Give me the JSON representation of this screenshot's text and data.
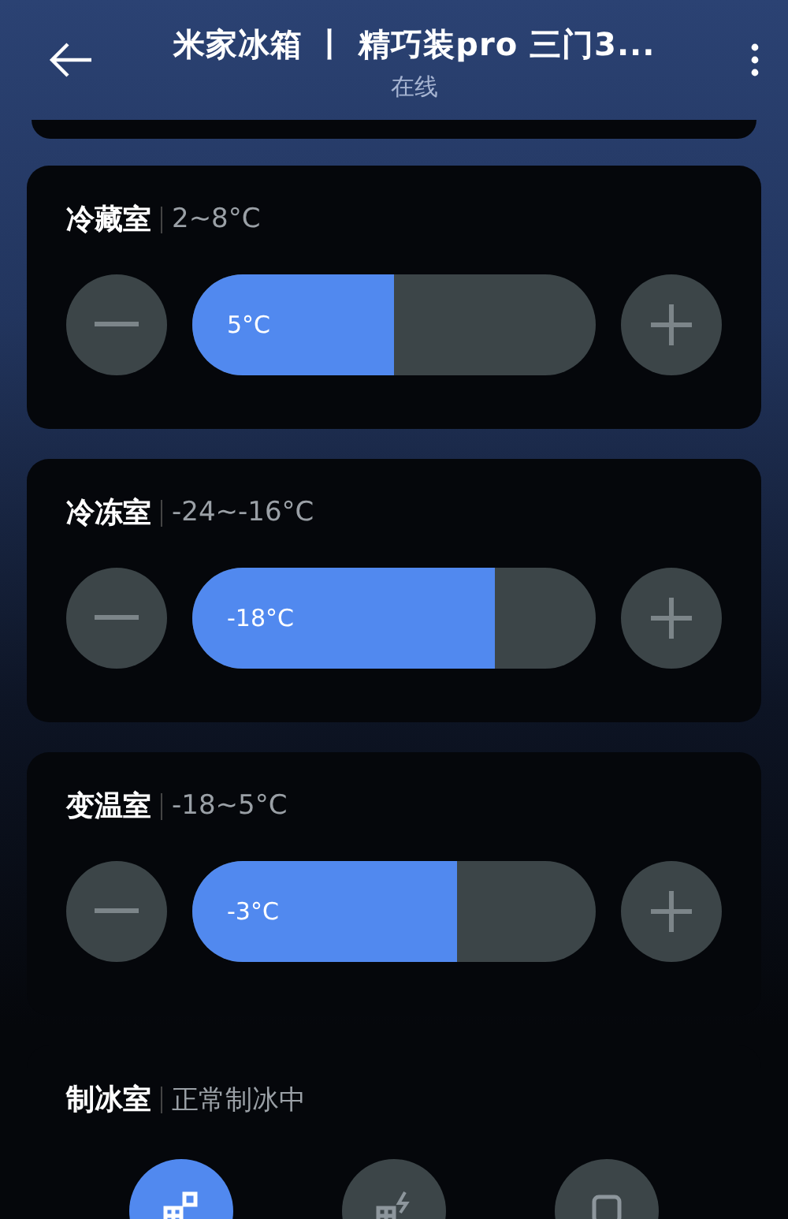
{
  "header": {
    "title": "米家冰箱 丨 精巧装pro 三门3...",
    "status": "在线"
  },
  "compartments": [
    {
      "name": "冷藏室",
      "range": "2~8°C",
      "reading": "5°C",
      "level": 0.5
    },
    {
      "name": "冷冻室",
      "range": "-24~-16°C",
      "reading": "-18°C",
      "level": 0.75
    },
    {
      "name": "变温室",
      "range": "-18~5°C",
      "reading": "-3°C",
      "level": 0.655
    }
  ],
  "ice_maker": {
    "name": "制冰室",
    "status": "正常制冰中",
    "modes": [
      {
        "kind": "normal",
        "selected": true
      },
      {
        "kind": "fast",
        "selected": false
      },
      {
        "kind": "off",
        "selected": false
      }
    ]
  }
}
